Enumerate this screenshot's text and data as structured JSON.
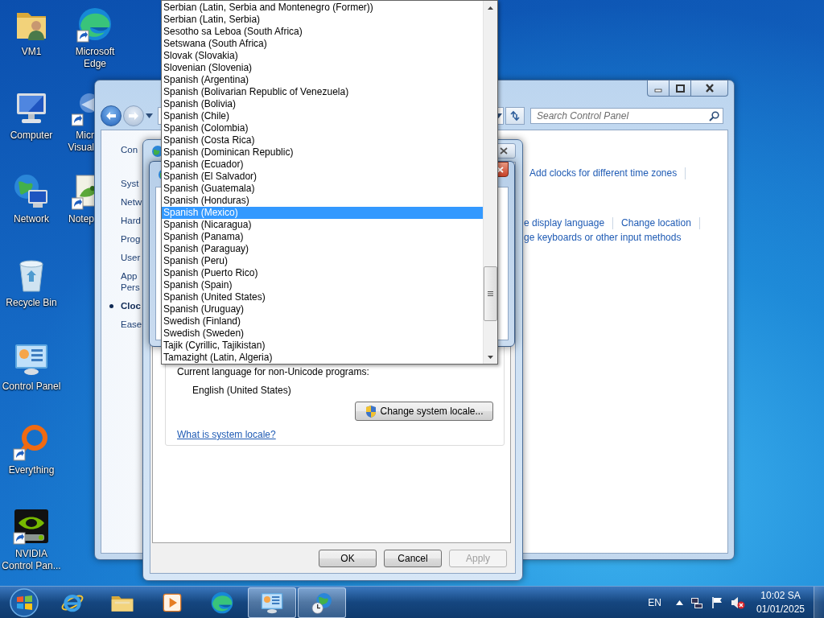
{
  "desktop_icons": [
    {
      "lines": [
        "VM1"
      ],
      "kind": "user-folder",
      "shortcut": false
    },
    {
      "lines": [
        "Computer"
      ],
      "kind": "computer",
      "shortcut": false
    },
    {
      "lines": [
        "Network"
      ],
      "kind": "network",
      "shortcut": false
    },
    {
      "lines": [
        "Recycle Bin"
      ],
      "kind": "recycle-bin",
      "shortcut": false
    },
    {
      "lines": [
        "Control Panel"
      ],
      "kind": "control-panel",
      "shortcut": false
    },
    {
      "lines": [
        "Everything"
      ],
      "kind": "everything",
      "shortcut": true
    },
    {
      "lines": [
        "NVIDIA",
        "Control Pan..."
      ],
      "kind": "nvidia",
      "shortcut": true
    }
  ],
  "desktop_icons_column_2": [
    {
      "lines": [
        "Microsoft",
        "Edge"
      ],
      "kind": "edge",
      "shortcut": true
    },
    {
      "lines": [
        "Micr",
        "Visual"
      ],
      "kind": "visual-studio",
      "shortcut": true
    },
    {
      "lines": [
        "Notep"
      ],
      "kind": "notepad",
      "shortcut": true
    }
  ],
  "control_panel": {
    "search": {
      "placeholder": "Search Control Panel"
    },
    "nav_items": [
      {
        "lines": [
          "Con"
        ],
        "selected": false
      },
      {
        "lines": [
          "Syst"
        ],
        "selected": false
      },
      {
        "lines": [
          "Netw"
        ],
        "selected": false
      },
      {
        "lines": [
          "Hard"
        ],
        "selected": false
      },
      {
        "lines": [
          "Prog"
        ],
        "selected": false
      },
      {
        "lines": [
          "User"
        ],
        "selected": false
      },
      {
        "lines": [
          "App",
          "Pers"
        ],
        "selected": false
      },
      {
        "lines": [
          "Cloc"
        ],
        "selected": true
      },
      {
        "lines": [
          "Ease"
        ],
        "selected": false
      }
    ],
    "link_rows": [
      [
        "Add clocks for different time zones"
      ],
      [
        "e display language",
        "Change location"
      ],
      [
        "ge keyboards or other input methods"
      ]
    ]
  },
  "region_dialog": {
    "non_unicode_label": "Current language for non-Unicode programs:",
    "current_locale": "English (United States)",
    "change_button": "Change system locale...",
    "help_link": "What is system locale?",
    "buttons": [
      {
        "label": "OK",
        "disabled": false
      },
      {
        "label": "Cancel",
        "disabled": false
      },
      {
        "label": "Apply",
        "disabled": true
      }
    ]
  },
  "locale_list": {
    "items": [
      {
        "label": "Serbian (Latin, Serbia and Montenegro (Former))",
        "selected": false
      },
      {
        "label": "Serbian (Latin, Serbia)",
        "selected": false
      },
      {
        "label": "Sesotho sa Leboa (South Africa)",
        "selected": false
      },
      {
        "label": "Setswana (South Africa)",
        "selected": false
      },
      {
        "label": "Slovak (Slovakia)",
        "selected": false
      },
      {
        "label": "Slovenian (Slovenia)",
        "selected": false
      },
      {
        "label": "Spanish (Argentina)",
        "selected": false
      },
      {
        "label": "Spanish (Bolivarian Republic of Venezuela)",
        "selected": false
      },
      {
        "label": "Spanish (Bolivia)",
        "selected": false
      },
      {
        "label": "Spanish (Chile)",
        "selected": false
      },
      {
        "label": "Spanish (Colombia)",
        "selected": false
      },
      {
        "label": "Spanish (Costa Rica)",
        "selected": false
      },
      {
        "label": "Spanish (Dominican Republic)",
        "selected": false
      },
      {
        "label": "Spanish (Ecuador)",
        "selected": false
      },
      {
        "label": "Spanish (El Salvador)",
        "selected": false
      },
      {
        "label": "Spanish (Guatemala)",
        "selected": false
      },
      {
        "label": "Spanish (Honduras)",
        "selected": false
      },
      {
        "label": "Spanish (Mexico)",
        "selected": true
      },
      {
        "label": "Spanish (Nicaragua)",
        "selected": false
      },
      {
        "label": "Spanish (Panama)",
        "selected": false
      },
      {
        "label": "Spanish (Paraguay)",
        "selected": false
      },
      {
        "label": "Spanish (Peru)",
        "selected": false
      },
      {
        "label": "Spanish (Puerto Rico)",
        "selected": false
      },
      {
        "label": "Spanish (Spain)",
        "selected": false
      },
      {
        "label": "Spanish (United States)",
        "selected": false
      },
      {
        "label": "Spanish (Uruguay)",
        "selected": false
      },
      {
        "label": "Swedish (Finland)",
        "selected": false
      },
      {
        "label": "Swedish (Sweden)",
        "selected": false
      },
      {
        "label": "Tajik (Cyrillic, Tajikistan)",
        "selected": false
      },
      {
        "label": "Tamazight (Latin, Algeria)",
        "selected": false
      }
    ]
  },
  "taskbar": {
    "apps": [
      {
        "kind": "ie",
        "active": false
      },
      {
        "kind": "explorer",
        "active": false
      },
      {
        "kind": "media",
        "active": false
      },
      {
        "kind": "edge",
        "active": false
      },
      {
        "kind": "control-panel",
        "active": true
      },
      {
        "kind": "region",
        "active": true
      }
    ],
    "language": "EN",
    "time": "10:02 SA",
    "date": "01/01/2025"
  }
}
